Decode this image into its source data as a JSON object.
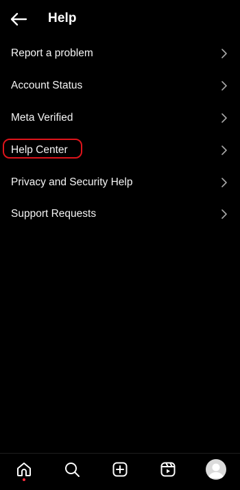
{
  "header": {
    "title": "Help",
    "back_icon": "arrow-left-icon"
  },
  "menu": {
    "items": [
      {
        "label": "Report a problem"
      },
      {
        "label": "Account Status"
      },
      {
        "label": "Meta Verified"
      },
      {
        "label": "Help Center",
        "highlighted": true
      },
      {
        "label": "Privacy and Security Help"
      },
      {
        "label": "Support Requests"
      }
    ],
    "chevron_icon": "chevron-right-icon"
  },
  "bottom_nav": {
    "items": [
      {
        "icon": "home-icon",
        "active": true
      },
      {
        "icon": "search-icon"
      },
      {
        "icon": "create-post-icon"
      },
      {
        "icon": "reels-icon"
      },
      {
        "icon": "profile-avatar"
      }
    ]
  },
  "colors": {
    "background": "#000000",
    "text": "#f5f5f5",
    "highlight": "#e0141b",
    "notification_dot": "#ff3040",
    "avatar": "#dbdbdb"
  }
}
